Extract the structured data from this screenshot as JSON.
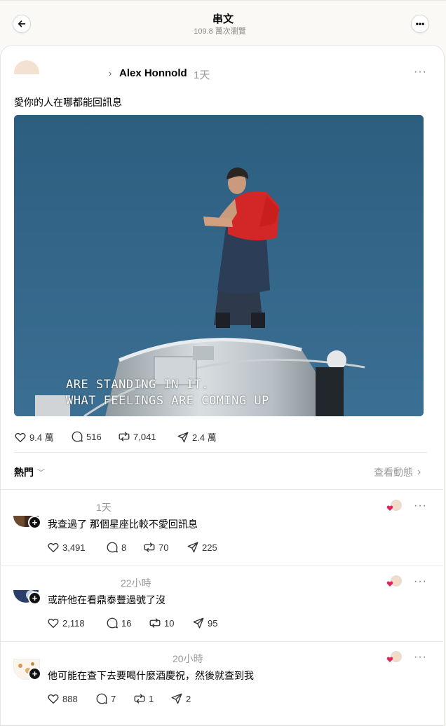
{
  "header": {
    "title": "串文",
    "subtitle": "109.8 萬次瀏覽"
  },
  "post": {
    "author": "Alex Honnold",
    "time": "1天",
    "text": "愛你的人在哪都能回訊息",
    "media": {
      "subtitle_line1": "ARE STANDING IN IT.",
      "subtitle_line2": "WHAT FEELINGS ARE COMING UP"
    },
    "stats": {
      "likes": "9.4 萬",
      "comments": "516",
      "reposts": "7,041",
      "shares": "2.4 萬"
    }
  },
  "sort": {
    "label": "熱門",
    "view_activity": "查看動態"
  },
  "replies": [
    {
      "time": "1天",
      "text": "我查過了 那個星座比較不愛回訊息",
      "likes": "3,491",
      "comments": "8",
      "reposts": "70",
      "shares": "225"
    },
    {
      "time": "22小時",
      "text": "或許他在看鼎泰豐過號了沒",
      "likes": "2,118",
      "comments": "16",
      "reposts": "10",
      "shares": "95"
    },
    {
      "time": "20小時",
      "text": "他可能在查下去要喝什麼酒慶祝，然後就查到我",
      "likes": "888",
      "comments": "7",
      "reposts": "1",
      "shares": "2"
    }
  ],
  "colors": {
    "background": "#faf9f5",
    "card": "#ffffff",
    "muted_text": "#999999",
    "heart_red": "#e0245e",
    "sky_blue": "#2f5f80"
  },
  "icons": [
    "back-arrow-icon",
    "more-icon",
    "chevron-right-icon",
    "chevron-down-icon",
    "heart-icon",
    "comment-icon",
    "repost-icon",
    "share-icon",
    "plus-icon"
  ]
}
